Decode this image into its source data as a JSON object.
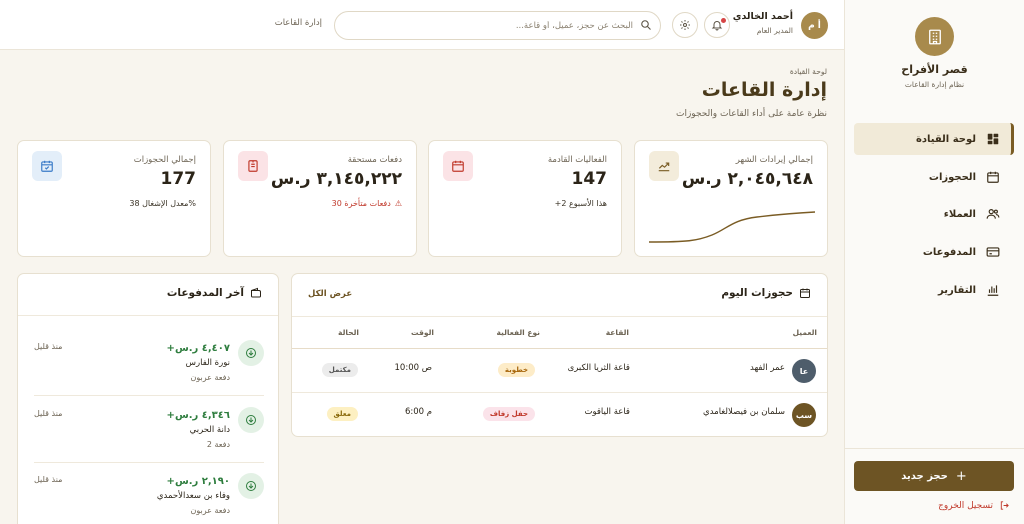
{
  "sidebar": {
    "brand_title": "قصر الأفراح",
    "brand_subtitle": "نظام إدارة القاعات",
    "nav": [
      {
        "label": "لوحة القيادة",
        "icon": "dashboard-icon",
        "active": true
      },
      {
        "label": "الحجوزات",
        "icon": "calendar-icon"
      },
      {
        "label": "العملاء",
        "icon": "users-icon"
      },
      {
        "label": "المدفوعات",
        "icon": "credit-card-icon"
      },
      {
        "label": "التقارير",
        "icon": "bar-chart-icon"
      }
    ],
    "new_booking": "حجز جديد",
    "logout": "تسجيل الخروج"
  },
  "header": {
    "avatar_initials": "أ م",
    "user_name": "أحمد الخالدي",
    "user_role": "المدير العام",
    "search_placeholder": "البحث عن حجز، عميل، أو قاعة...",
    "label": "إدارة القاعات"
  },
  "page": {
    "breadcrumb": "لوحة القيادة",
    "title": "إدارة القاعات",
    "subtitle": "نظرة عامة على أداء القاعات والحجوزات"
  },
  "stats": [
    {
      "label": "إجمالي إيرادات الشهر",
      "value": "٢,٠٤٥,٦٤٨ ر.س",
      "foot": "",
      "icon": "trending-up-icon",
      "color": "#f3ecdb",
      "ink": "#7a5c24"
    },
    {
      "label": "الفعاليات القادمة",
      "value": "147",
      "foot": "+2 هذا الأسبوع",
      "icon": "calendar-icon",
      "color": "#fbe3e6",
      "ink": "#c0392b"
    },
    {
      "label": "دفعات مستحقة",
      "value": "٣,١٤٥,٢٢٢ ر.س",
      "foot": "30 دفعات متأخرة",
      "icon": "receipt-icon",
      "color": "#fbe3e6",
      "ink": "#c0392b"
    },
    {
      "label": "إجمالي الحجوزات",
      "value": "177",
      "foot": "معدل الإشغال 38%",
      "icon": "calendar-check-icon",
      "color": "#e3eef9",
      "ink": "#3a7bc8"
    }
  ],
  "bookings": {
    "title": "حجوزات اليوم",
    "view_all": "عرض الكل",
    "columns": [
      "العميل",
      "القاعة",
      "نوع الفعالية",
      "الوقت",
      "الحالة"
    ],
    "rows": [
      {
        "initials": "عا",
        "avatar_color": "#4e5d6b",
        "client": "عمر الفهد",
        "hall": "قاعة الثريا الكبرى",
        "event": "خطوبة",
        "event_bg": "#fdecc8",
        "event_fg": "#a8670c",
        "time": "10:00 ص",
        "status": "مكتمل",
        "status_bg": "#ececec",
        "status_fg": "#555555"
      },
      {
        "initials": "سب",
        "avatar_color": "#6d5424",
        "client": "سلمان بن فيصلالغامدي",
        "hall": "قاعة الياقوت",
        "event": "حفل زفاف",
        "event_bg": "#fbe3ea",
        "event_fg": "#c0392b",
        "time": "6:00 م",
        "status": "معلق",
        "status_bg": "#fdf0c2",
        "status_fg": "#8a6a0c"
      }
    ]
  },
  "payments": {
    "title": "آخر المدفوعات",
    "items": [
      {
        "amount": "+٤,٤٠٧ ر.س",
        "name": "نورة الفارس",
        "note": "دفعة عربون",
        "time": "منذ قليل"
      },
      {
        "amount": "+٤,٣٤٦ ر.س",
        "name": "دانة الحربي",
        "note": "دفعة 2",
        "time": "منذ قليل"
      },
      {
        "amount": "+٢,١٩٠ ر.س",
        "name": "وفاء بن سعدالأحمدي",
        "note": "دفعة عربون",
        "time": "منذ قليل"
      }
    ]
  }
}
